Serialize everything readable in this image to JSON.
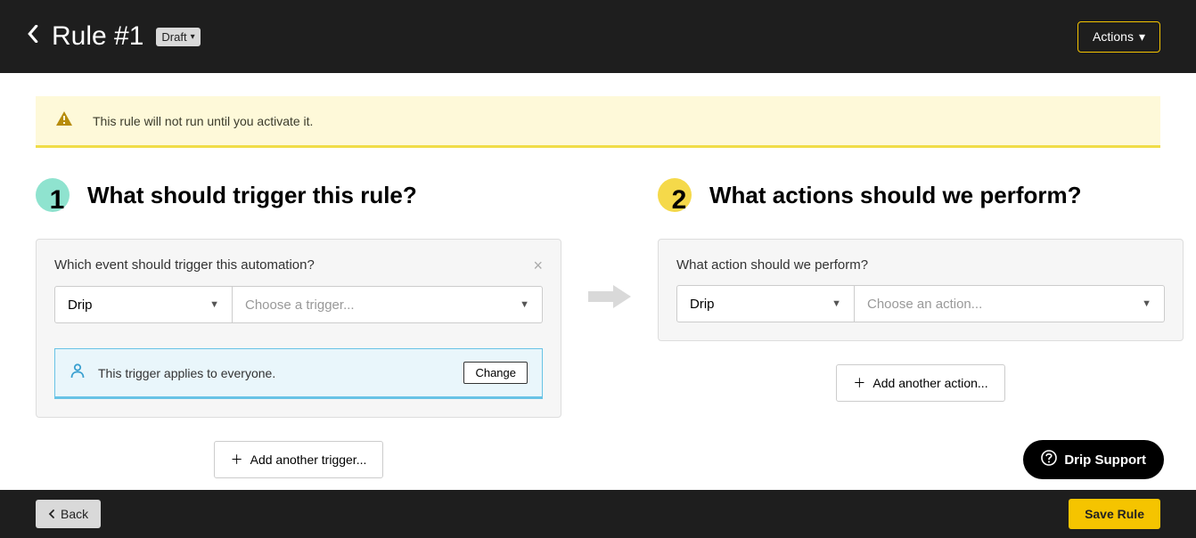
{
  "header": {
    "title": "Rule #1",
    "status": "Draft",
    "actions_label": "Actions"
  },
  "alert": {
    "text": "This rule will not run until you activate it."
  },
  "trigger": {
    "step_num": "1",
    "title": "What should trigger this rule?",
    "question": "Which event should trigger this automation?",
    "provider": "Drip",
    "placeholder": "Choose a trigger...",
    "applies_text": "This trigger applies to everyone.",
    "change_label": "Change",
    "add_label": "Add another trigger..."
  },
  "action": {
    "step_num": "2",
    "title": "What actions should we perform?",
    "question": "What action should we perform?",
    "provider": "Drip",
    "placeholder": "Choose an action...",
    "add_label": "Add another action..."
  },
  "footer": {
    "back_label": "Back",
    "save_label": "Save Rule"
  },
  "support": {
    "label": "Drip Support"
  }
}
